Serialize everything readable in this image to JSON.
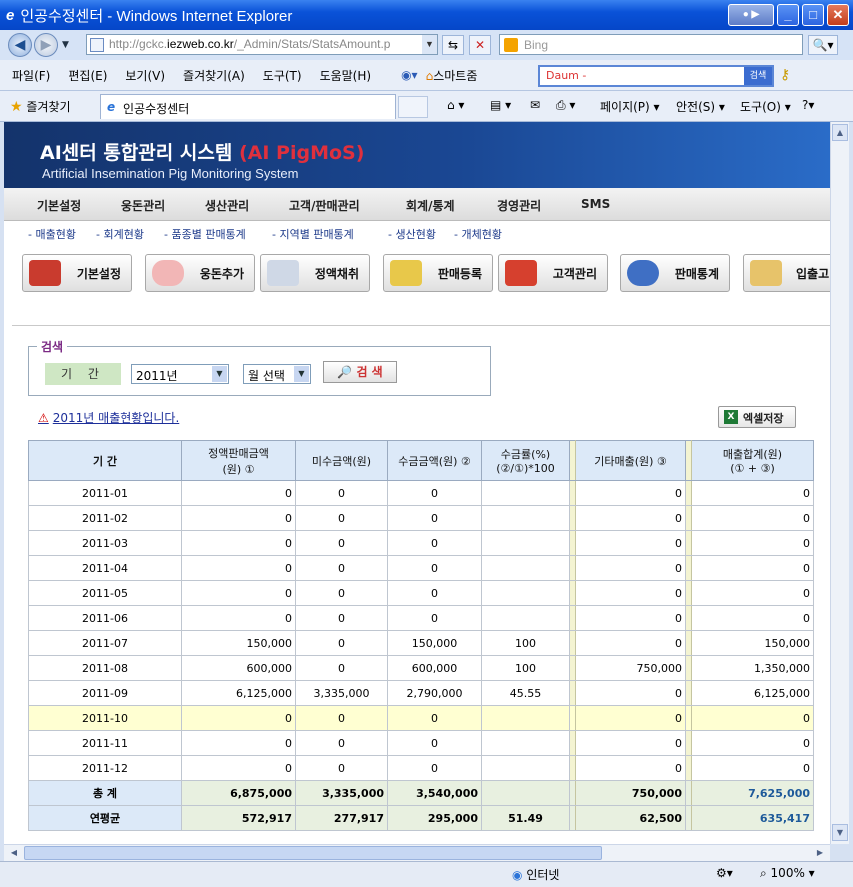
{
  "window": {
    "title": "인공수정센터 - Windows Internet Explorer",
    "title_icon": "ie-icon"
  },
  "address": {
    "url_prefix": "http://gckc.",
    "url_host": "iezweb.co.kr",
    "url_suffix": "/_Admin/Stats/StatsAmount.p",
    "search_placeholder": "Bing"
  },
  "menu": {
    "items": [
      "파일(F)",
      "편집(E)",
      "보기(V)",
      "즐겨찾기(A)",
      "도구(T)",
      "도움말(H)"
    ],
    "smart": "스마트줌",
    "daum_text": "Daum -",
    "daum_btn": "검색"
  },
  "favbar": {
    "favorites": "즐겨찾기",
    "tab_title": "인공수정센터",
    "page": "페이지(P)",
    "safety": "안전(S)",
    "tools": "도구(O)"
  },
  "banner": {
    "title": "AI센터 통합관리 시스템",
    "title_accent": "(AI PigMoS)",
    "subtitle": "Artificial Insemination Pig Monitoring System"
  },
  "mainnav": [
    "기본설정",
    "웅돈관리",
    "생산관리",
    "고객/판매관리",
    "회계/통계",
    "경영관리",
    "SMS"
  ],
  "subnav": [
    "- 매출현황",
    "- 회계현황",
    "- 품종별 판매통계",
    "- 지역별 판매통계",
    "- 생산현황",
    "- 개체현황"
  ],
  "iconbar": [
    "기본설정",
    "웅돈추가",
    "정액채취",
    "판매등록",
    "고객관리",
    "판매통계",
    "입출고"
  ],
  "search": {
    "legend": "검색",
    "period_label": "기 간",
    "year": "2011년",
    "month": "월 선택",
    "button": "검 색"
  },
  "notice": "2011년 매출현황입니다.",
  "excel_button": "엑셀저장",
  "table": {
    "headers": [
      "기 간",
      "정액판매금액\n(원) ①",
      "미수금액(원)",
      "수금금액(원) ②",
      "수금률(%)\n(②/①)*100",
      "기타매출(원) ③",
      "매출합계(원)\n(① + ③)"
    ],
    "rows": [
      [
        "2011-01",
        "0",
        "0",
        "0",
        "",
        "0",
        "0"
      ],
      [
        "2011-02",
        "0",
        "0",
        "0",
        "",
        "0",
        "0"
      ],
      [
        "2011-03",
        "0",
        "0",
        "0",
        "",
        "0",
        "0"
      ],
      [
        "2011-04",
        "0",
        "0",
        "0",
        "",
        "0",
        "0"
      ],
      [
        "2011-05",
        "0",
        "0",
        "0",
        "",
        "0",
        "0"
      ],
      [
        "2011-06",
        "0",
        "0",
        "0",
        "",
        "0",
        "0"
      ],
      [
        "2011-07",
        "150,000",
        "0",
        "150,000",
        "100",
        "0",
        "150,000"
      ],
      [
        "2011-08",
        "600,000",
        "0",
        "600,000",
        "100",
        "750,000",
        "1,350,000"
      ],
      [
        "2011-09",
        "6,125,000",
        "3,335,000",
        "2,790,000",
        "45.55",
        "0",
        "6,125,000"
      ],
      [
        "2011-10",
        "0",
        "0",
        "0",
        "",
        "0",
        "0"
      ],
      [
        "2011-11",
        "0",
        "0",
        "0",
        "",
        "0",
        "0"
      ],
      [
        "2011-12",
        "0",
        "0",
        "0",
        "",
        "0",
        "0"
      ]
    ],
    "total": [
      "총 계",
      "6,875,000",
      "3,335,000",
      "3,540,000",
      "",
      "750,000",
      "7,625,000"
    ],
    "average": [
      "연평균",
      "572,917",
      "277,917",
      "295,000",
      "51.49",
      "62,500",
      "635,417"
    ]
  },
  "status": {
    "zone": "인터넷",
    "zoom": "100%"
  }
}
